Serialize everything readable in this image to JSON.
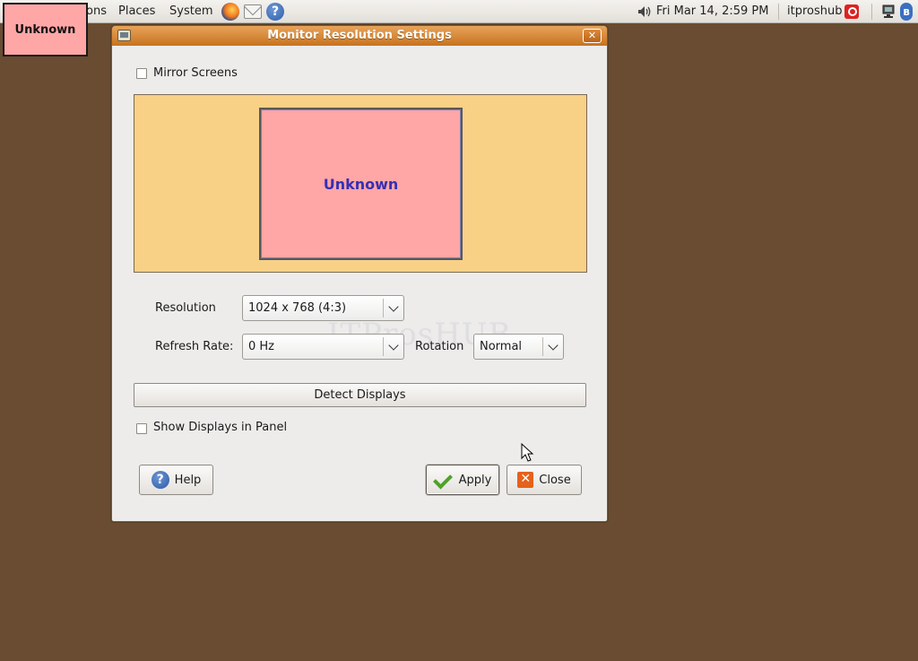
{
  "top_panel": {
    "menus": [
      "ons",
      "Places",
      "System"
    ],
    "datetime": "Fri Mar 14,  2:59 PM",
    "username": "itproshub"
  },
  "output_label": "Unknown",
  "dialog": {
    "title": "Monitor Resolution Settings",
    "mirror_screens": {
      "label": "Mirror Screens",
      "checked": false
    },
    "monitor_name": "Unknown",
    "resolution": {
      "label": "Resolution",
      "value": "1024 x 768 (4:3)"
    },
    "refresh_rate": {
      "label": "Refresh Rate:",
      "value": "0 Hz"
    },
    "rotation": {
      "label": "Rotation",
      "value": "Normal"
    },
    "detect_button": "Detect Displays",
    "show_in_panel": {
      "label": "Show Displays in Panel",
      "checked": false
    },
    "help_button": "Help",
    "apply_button": "Apply",
    "close_button": "Close"
  },
  "watermark": "ITProsHUB",
  "colors": {
    "desktop": "#694c31",
    "titlebar": "#d4883a",
    "monitor_area": "#f8d187",
    "monitor_box": "#ffa6a6",
    "monitor_text": "#3530b4"
  }
}
